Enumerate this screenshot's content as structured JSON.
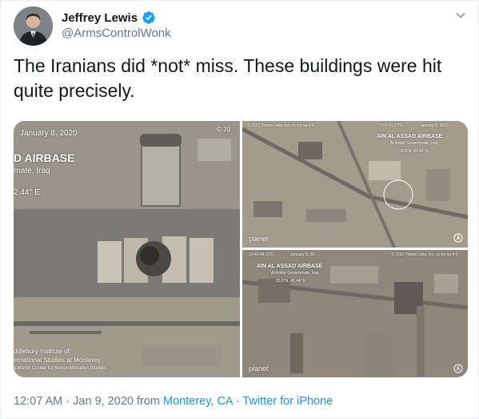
{
  "author": {
    "name": "Jeffrey Lewis",
    "handle": "@ArmsControlWonk",
    "verified": true
  },
  "tweet": {
    "text": "The Iranians did *not* miss. These buildings were hit quite precisely."
  },
  "media": {
    "left_image": {
      "date": "January 8, 2020",
      "copyright": "© 20",
      "title": "D AIRBASE",
      "location": "rnate, Iraq",
      "coords": "2.44° E",
      "credit_line1": "ddlebury Institute of",
      "credit_line2": "ernational Studies at Monterey",
      "credit_line3": "s Martin Center for Nonproliferation Studies"
    },
    "top_right_image": {
      "copyright": "© 2020 Planet Labs, Inc. cc-by-sa 4.0",
      "time": "7:07:41 UTC",
      "date": "January 8, 2020",
      "title": "AIN AL ASSAD AIRBASE",
      "location": "Al Anbar Governorate, Iraq",
      "coords": "33.8°N, 42.44° E",
      "brand": "planet"
    },
    "bottom_right_image": {
      "time": "13:42:48 UTC",
      "date": "January 8, 20",
      "copyright": "© 2020 Planet Labs, Inc. cc-by-sa 4.0",
      "title": "AIN AL ASSAD AIRBASE",
      "location": "Al Anbar Governorate, Iraq",
      "coords": "33.8°N, 42.44° E",
      "brand": "planet"
    }
  },
  "footer": {
    "time": "12:07 AM",
    "sep1": " · ",
    "date": "Jan 9, 2020",
    "from": " from ",
    "place": "Monterey, CA",
    "sep2": " · ",
    "client": "Twitter for iPhone"
  },
  "colors": {
    "link": "#1b95e0",
    "verified": "#1da1f2",
    "meta": "#657786"
  }
}
